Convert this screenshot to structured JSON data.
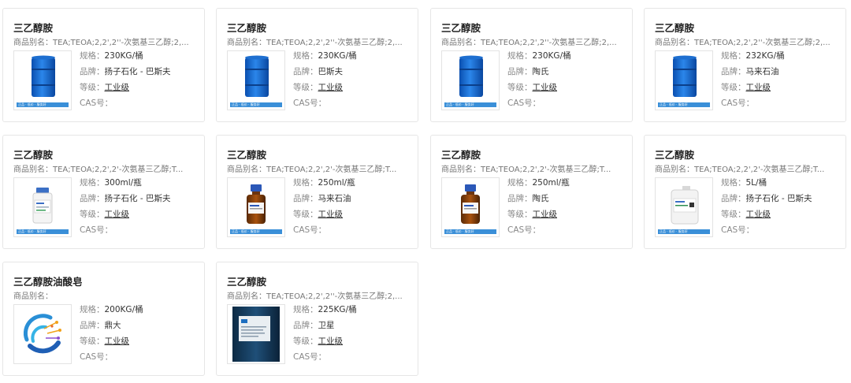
{
  "labels": {
    "alias": "商品别名：",
    "spec": "规格：",
    "brand": "品牌：",
    "grade": "等级：",
    "cas": "CAS号："
  },
  "thumb_banner": "正品 · 低价 · 服务好",
  "products": [
    {
      "name": "三乙醇胺",
      "alias": "TEA;TEOA;2,2',2''-次氨基三乙醇;2,...",
      "spec": "230KG/桶",
      "brand": "扬子石化 - 巴斯夫",
      "grade": "工业级",
      "image": "blue-drum-icon"
    },
    {
      "name": "三乙醇胺",
      "alias": "TEA;TEOA;2,2',2''-次氨基三乙醇;2,...",
      "spec": "230KG/桶",
      "brand": "巴斯夫",
      "grade": "工业级",
      "image": "blue-drum-icon"
    },
    {
      "name": "三乙醇胺",
      "alias": "TEA;TEOA;2,2',2''-次氨基三乙醇;2,...",
      "spec": "230KG/桶",
      "brand": "陶氏",
      "grade": "工业级",
      "image": "blue-drum-icon"
    },
    {
      "name": "三乙醇胺",
      "alias": "TEA;TEOA;2,2',2''-次氨基三乙醇;2,...",
      "spec": "232KG/桶",
      "brand": "马来石油",
      "grade": "工业级",
      "image": "blue-drum-icon"
    },
    {
      "name": "三乙醇胺",
      "alias": "TEA;TEOA;2,2',2'-次氨基三乙醇;T...",
      "spec": "300ml/瓶",
      "brand": "扬子石化 - 巴斯夫",
      "grade": "工业级",
      "image": "white-bottle-icon"
    },
    {
      "name": "三乙醇胺",
      "alias": "TEA;TEOA;2,2',2'-次氨基三乙醇;T...",
      "spec": "250ml/瓶",
      "brand": "马来石油",
      "grade": "工业级",
      "image": "amber-bottle-icon"
    },
    {
      "name": "三乙醇胺",
      "alias": "TEA;TEOA;2,2',2'-次氨基三乙醇;T...",
      "spec": "250ml/瓶",
      "brand": "陶氏",
      "grade": "工业级",
      "image": "amber-bottle-icon"
    },
    {
      "name": "三乙醇胺",
      "alias": "TEA;TEOA;2,2',2'-次氨基三乙醇;T...",
      "spec": "5L/桶",
      "brand": "扬子石化 - 巴斯夫",
      "grade": "工业级",
      "image": "white-jerrycan-icon"
    },
    {
      "name": "三乙醇胺油酸皂",
      "alias": "",
      "spec": "200KG/桶",
      "brand": "鼎大",
      "grade": "工业级",
      "image": "circuit-logo-icon"
    },
    {
      "name": "三乙醇胺",
      "alias": "TEA;TEOA;2,2',2''-次氨基三乙醇;2,...",
      "spec": "225KG/桶",
      "brand": "卫星",
      "grade": "工业级",
      "image": "dark-drum-photo-icon"
    }
  ]
}
